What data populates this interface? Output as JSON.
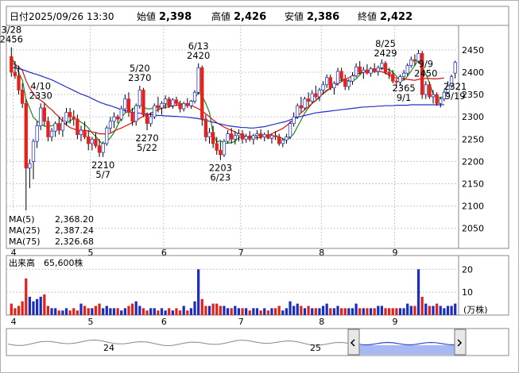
{
  "header": {
    "date_label": "日付",
    "date": "2025/09/26 13:30",
    "open_label": "始値",
    "open": "2,398",
    "high_label": "高値",
    "high": "2,426",
    "low_label": "安値",
    "low": "2,386",
    "close_label": "終値",
    "close": "2,422"
  },
  "colors": {
    "up": "#2b3fc5",
    "down": "#e8201a",
    "ma5": "#1a8a1a",
    "ma25": "#d81010",
    "ma75": "#2030c8",
    "volume_up": "#1a2dbb",
    "volume_down": "#e0201a",
    "high_value": "#e8201a",
    "low_value": "#1a8a1a",
    "grid": "#c8c8c8",
    "navigator_range": "#a8b8f0"
  },
  "legend": {
    "ma5_label": "MA(5)",
    "ma5_value": "2,368.20",
    "ma25_label": "MA(25)",
    "ma25_value": "2,387.24",
    "ma75_label": "MA(75)",
    "ma75_value": "2,326.68"
  },
  "volume_panel": {
    "label": "出来高",
    "value": "65,600株",
    "unit": "(万株)",
    "ticks": [
      "10",
      "20"
    ]
  },
  "navigator": {
    "labels": [
      "24",
      "25"
    ],
    "left_handle_icon": "chevron-left-icon",
    "right_handle_icon": "chevron-right-icon"
  },
  "chart_data": {
    "type": "candlestick",
    "title": "",
    "xlabel": "",
    "ylabel": "",
    "ylim": [
      2005,
      2505
    ],
    "y_ticks": [
      2050,
      2100,
      2150,
      2200,
      2250,
      2300,
      2350,
      2400,
      2450
    ],
    "x_month_ticks": [
      {
        "label": "4",
        "index": 1
      },
      {
        "label": "5",
        "index": 22
      },
      {
        "label": "6",
        "index": 42
      },
      {
        "label": "7",
        "index": 63
      },
      {
        "label": "8",
        "index": 85
      },
      {
        "label": "9",
        "index": 105
      }
    ],
    "grid": true,
    "legend_position": "bottom-left",
    "annotations": [
      {
        "date": "3/28",
        "value": "2456",
        "index": 0,
        "anchor": "high"
      },
      {
        "date": "4/10",
        "value": "2330",
        "index": 8,
        "anchor": "high"
      },
      {
        "date": "5/7",
        "value": "2210",
        "index": 25,
        "anchor": "low"
      },
      {
        "date": "5/20",
        "value": "2370",
        "index": 35,
        "anchor": "high"
      },
      {
        "date": "5/22",
        "value": "2270",
        "index": 37,
        "anchor": "low"
      },
      {
        "date": "6/13",
        "value": "2420",
        "index": 51,
        "anchor": "high"
      },
      {
        "date": "6/23",
        "value": "2203",
        "index": 57,
        "anchor": "low"
      },
      {
        "date": "8/25",
        "value": "2429",
        "index": 102,
        "anchor": "high"
      },
      {
        "date": "9/1",
        "value": "2365",
        "index": 107,
        "anchor": "low"
      },
      {
        "date": "9/9",
        "value": "2450",
        "index": 113,
        "anchor": "high"
      },
      {
        "date": "9/19",
        "value": "2321",
        "index": 121,
        "anchor": "low"
      }
    ],
    "candles": [
      [
        2435,
        2456,
        2390,
        2400
      ],
      [
        2400,
        2425,
        2385,
        2392
      ],
      [
        2392,
        2415,
        2350,
        2360
      ],
      [
        2360,
        2375,
        2320,
        2330
      ],
      [
        2330,
        2340,
        2060,
        2185
      ],
      [
        2185,
        2205,
        2140,
        2195
      ],
      [
        2200,
        2250,
        2160,
        2245
      ],
      [
        2245,
        2290,
        2230,
        2280
      ],
      [
        2280,
        2330,
        2270,
        2320
      ],
      [
        2320,
        2330,
        2280,
        2290
      ],
      [
        2290,
        2300,
        2245,
        2255
      ],
      [
        2255,
        2275,
        2245,
        2268
      ],
      [
        2268,
        2290,
        2255,
        2285
      ],
      [
        2285,
        2300,
        2260,
        2270
      ],
      [
        2270,
        2300,
        2255,
        2290
      ],
      [
        2290,
        2320,
        2280,
        2310
      ],
      [
        2310,
        2320,
        2285,
        2300
      ],
      [
        2300,
        2315,
        2280,
        2295
      ],
      [
        2295,
        2305,
        2250,
        2260
      ],
      [
        2260,
        2280,
        2245,
        2270
      ],
      [
        2270,
        2290,
        2250,
        2255
      ],
      [
        2255,
        2270,
        2225,
        2240
      ],
      [
        2240,
        2255,
        2225,
        2250
      ],
      [
        2250,
        2265,
        2230,
        2235
      ],
      [
        2235,
        2250,
        2210,
        2220
      ],
      [
        2220,
        2245,
        2210,
        2240
      ],
      [
        2240,
        2280,
        2235,
        2275
      ],
      [
        2275,
        2300,
        2265,
        2290
      ],
      [
        2290,
        2310,
        2275,
        2300
      ],
      [
        2300,
        2305,
        2285,
        2295
      ],
      [
        2295,
        2325,
        2290,
        2318
      ],
      [
        2318,
        2350,
        2310,
        2340
      ],
      [
        2340,
        2355,
        2300,
        2310
      ],
      [
        2310,
        2320,
        2280,
        2290
      ],
      [
        2290,
        2330,
        2280,
        2325
      ],
      [
        2325,
        2370,
        2318,
        2360
      ],
      [
        2360,
        2365,
        2300,
        2305
      ],
      [
        2305,
        2310,
        2270,
        2285
      ],
      [
        2285,
        2310,
        2278,
        2300
      ],
      [
        2300,
        2330,
        2295,
        2325
      ],
      [
        2325,
        2345,
        2310,
        2320
      ],
      [
        2320,
        2335,
        2305,
        2330
      ],
      [
        2330,
        2348,
        2318,
        2340
      ],
      [
        2340,
        2345,
        2320,
        2325
      ],
      [
        2325,
        2342,
        2318,
        2338
      ],
      [
        2338,
        2345,
        2325,
        2330
      ],
      [
        2330,
        2336,
        2310,
        2318
      ],
      [
        2318,
        2334,
        2312,
        2330
      ],
      [
        2330,
        2342,
        2320,
        2325
      ],
      [
        2325,
        2338,
        2318,
        2335
      ],
      [
        2335,
        2360,
        2330,
        2355
      ],
      [
        2355,
        2420,
        2350,
        2410
      ],
      [
        2410,
        2415,
        2280,
        2295
      ],
      [
        2295,
        2305,
        2245,
        2255
      ],
      [
        2255,
        2275,
        2240,
        2265
      ],
      [
        2265,
        2280,
        2230,
        2240
      ],
      [
        2240,
        2255,
        2215,
        2225
      ],
      [
        2225,
        2245,
        2203,
        2215
      ],
      [
        2215,
        2250,
        2210,
        2245
      ],
      [
        2245,
        2270,
        2240,
        2262
      ],
      [
        2262,
        2275,
        2240,
        2250
      ],
      [
        2250,
        2268,
        2238,
        2258
      ],
      [
        2258,
        2272,
        2245,
        2262
      ],
      [
        2262,
        2270,
        2240,
        2250
      ],
      [
        2250,
        2262,
        2242,
        2256
      ],
      [
        2256,
        2268,
        2245,
        2250
      ],
      [
        2250,
        2262,
        2238,
        2258
      ],
      [
        2258,
        2270,
        2248,
        2262
      ],
      [
        2262,
        2272,
        2250,
        2255
      ],
      [
        2255,
        2265,
        2245,
        2260
      ],
      [
        2260,
        2270,
        2250,
        2252
      ],
      [
        2252,
        2262,
        2240,
        2258
      ],
      [
        2258,
        2268,
        2248,
        2255
      ],
      [
        2255,
        2262,
        2235,
        2240
      ],
      [
        2240,
        2252,
        2232,
        2248
      ],
      [
        2248,
        2262,
        2240,
        2255
      ],
      [
        2255,
        2290,
        2250,
        2285
      ],
      [
        2285,
        2310,
        2278,
        2300
      ],
      [
        2300,
        2330,
        2295,
        2325
      ],
      [
        2325,
        2345,
        2310,
        2320
      ],
      [
        2320,
        2345,
        2315,
        2340
      ],
      [
        2340,
        2355,
        2325,
        2335
      ],
      [
        2335,
        2360,
        2330,
        2352
      ],
      [
        2352,
        2370,
        2340,
        2345
      ],
      [
        2345,
        2365,
        2335,
        2360
      ],
      [
        2360,
        2380,
        2350,
        2372
      ],
      [
        2372,
        2395,
        2365,
        2388
      ],
      [
        2388,
        2395,
        2360,
        2365
      ],
      [
        2365,
        2380,
        2350,
        2375
      ],
      [
        2375,
        2410,
        2370,
        2402
      ],
      [
        2402,
        2410,
        2380,
        2385
      ],
      [
        2385,
        2395,
        2360,
        2368
      ],
      [
        2368,
        2385,
        2360,
        2380
      ],
      [
        2380,
        2400,
        2372,
        2392
      ],
      [
        2392,
        2420,
        2388,
        2412
      ],
      [
        2412,
        2425,
        2395,
        2400
      ],
      [
        2400,
        2412,
        2385,
        2405
      ],
      [
        2405,
        2418,
        2395,
        2398
      ],
      [
        2398,
        2412,
        2390,
        2408
      ],
      [
        2408,
        2420,
        2398,
        2402
      ],
      [
        2402,
        2415,
        2392,
        2410
      ],
      [
        2410,
        2429,
        2405,
        2420
      ],
      [
        2420,
        2425,
        2395,
        2400
      ],
      [
        2400,
        2410,
        2385,
        2395
      ],
      [
        2395,
        2405,
        2375,
        2380
      ],
      [
        2380,
        2385,
        2365,
        2378
      ],
      [
        2378,
        2395,
        2370,
        2390
      ],
      [
        2390,
        2405,
        2382,
        2398
      ],
      [
        2398,
        2420,
        2392,
        2415
      ],
      [
        2415,
        2435,
        2410,
        2428
      ],
      [
        2428,
        2440,
        2415,
        2425
      ],
      [
        2425,
        2450,
        2420,
        2442
      ],
      [
        2442,
        2448,
        2340,
        2350
      ],
      [
        2350,
        2380,
        2340,
        2372
      ],
      [
        2372,
        2378,
        2340,
        2345
      ],
      [
        2345,
        2360,
        2330,
        2350
      ],
      [
        2350,
        2355,
        2325,
        2330
      ],
      [
        2330,
        2345,
        2321,
        2340
      ],
      [
        2340,
        2360,
        2335,
        2355
      ],
      [
        2355,
        2380,
        2350,
        2370
      ],
      [
        2370,
        2395,
        2365,
        2390
      ],
      [
        2398,
        2426,
        2386,
        2422
      ]
    ],
    "volumes": [
      5,
      3,
      4,
      6,
      16,
      8,
      6,
      7,
      8,
      9,
      4,
      3,
      3,
      2,
      2,
      3,
      2,
      3,
      2,
      5,
      4,
      3,
      3,
      4,
      5,
      3,
      4,
      3,
      3,
      3,
      2,
      3,
      4,
      5,
      6,
      4,
      3,
      2,
      3,
      3,
      2,
      3,
      2,
      3,
      2,
      3,
      2,
      4,
      2,
      3,
      6,
      20,
      7,
      4,
      4,
      5,
      5,
      4,
      4,
      3,
      3,
      4,
      3,
      3,
      3,
      2,
      3,
      3,
      2,
      3,
      2,
      3,
      3,
      4,
      2,
      3,
      6,
      4,
      5,
      4,
      3,
      4,
      3,
      3,
      3,
      4,
      5,
      3,
      3,
      4,
      3,
      3,
      3,
      3,
      5,
      3,
      3,
      3,
      3,
      3,
      4,
      4,
      3,
      3,
      3,
      3,
      3,
      3,
      5,
      4,
      4,
      20,
      8,
      5,
      4,
      4,
      5,
      4,
      3,
      4,
      4,
      5
    ],
    "series": [
      {
        "name": "MA(5)",
        "values": [
          2435,
          2418,
          2399,
          2382,
          2339,
          2319,
          2299,
          2291,
          2285,
          2279,
          2278,
          2280,
          2283,
          2281,
          2282,
          2285,
          2291,
          2296,
          2294,
          2288,
          2283,
          2275,
          2264,
          2256,
          2246,
          2238,
          2244,
          2253,
          2265,
          2281,
          2298,
          2309,
          2311,
          2317,
          2323,
          2328,
          2322,
          2318,
          2318,
          2322,
          2323,
          2320,
          2326,
          2329,
          2331,
          2333,
          2330,
          2328,
          2329,
          2329,
          2341,
          2355,
          2347,
          2330,
          2310,
          2263,
          2243,
          2247,
          2240,
          2241,
          2242,
          2245,
          2253,
          2256,
          2255,
          2257,
          2256,
          2258,
          2258,
          2259,
          2258,
          2258,
          2257,
          2255,
          2251,
          2248,
          2254,
          2262,
          2278,
          2293,
          2309,
          2320,
          2330,
          2336,
          2343,
          2353,
          2360,
          2364,
          2372,
          2379,
          2383,
          2384,
          2380,
          2380,
          2385,
          2394,
          2402,
          2404,
          2406,
          2404,
          2405,
          2409,
          2406,
          2406,
          2400,
          2391,
          2381,
          2382,
          2391,
          2403,
          2415,
          2429,
          2411,
          2396,
          2376,
          2351,
          2344,
          2343,
          2345,
          2361,
          2382
        ]
      },
      {
        "name": "MA(25)",
        "values": [
          2420,
          2418,
          2412,
          2404,
          2381,
          2364,
          2352,
          2342,
          2337,
          2331,
          2322,
          2316,
          2307,
          2300,
          2290,
          2282,
          2276,
          2273,
          2270,
          2270,
          2270,
          2268,
          2266,
          2265,
          2262,
          2262,
          2261,
          2263,
          2268,
          2272,
          2275,
          2279,
          2283,
          2287,
          2291,
          2297,
          2301,
          2305,
          2308,
          2312,
          2316,
          2319,
          2321,
          2323,
          2324,
          2326,
          2327,
          2326,
          2326,
          2325,
          2322,
          2318,
          2313,
          2307,
          2300,
          2293,
          2287,
          2282,
          2277,
          2273,
          2270,
          2266,
          2262,
          2259,
          2256,
          2254,
          2253,
          2253,
          2254,
          2257,
          2259,
          2262,
          2266,
          2270,
          2274,
          2280,
          2287,
          2294,
          2302,
          2309,
          2316,
          2323,
          2330,
          2337,
          2345,
          2352,
          2358,
          2364,
          2369,
          2374,
          2379,
          2384,
          2388,
          2392,
          2395,
          2398,
          2400,
          2401,
          2402,
          2402,
          2402,
          2401,
          2398,
          2393,
          2389,
          2387,
          2386,
          2385,
          2384,
          2383,
          2382,
          2384,
          2385,
          2386,
          2386,
          2385,
          2385,
          2386,
          2387
        ]
      },
      {
        "name": "MA(75)",
        "values": [
          2410,
          2410,
          2408,
          2406,
          2403,
          2400,
          2397,
          2395,
          2392,
          2389,
          2386,
          2383,
          2379,
          2375,
          2371,
          2367,
          2363,
          2359,
          2355,
          2351,
          2348,
          2345,
          2341,
          2337,
          2333,
          2330,
          2327,
          2325,
          2322,
          2319,
          2316,
          2314,
          2312,
          2310,
          2309,
          2308,
          2307,
          2306,
          2305,
          2304,
          2303,
          2303,
          2302,
          2302,
          2301,
          2301,
          2300,
          2300,
          2299,
          2298,
          2297,
          2296,
          2294,
          2292,
          2290,
          2288,
          2286,
          2284,
          2282,
          2280,
          2279,
          2278,
          2277,
          2276,
          2276,
          2275,
          2275,
          2276,
          2277,
          2278,
          2280,
          2282,
          2284,
          2286,
          2288,
          2290,
          2293,
          2296,
          2299,
          2301,
          2303,
          2305,
          2307,
          2309,
          2310,
          2311,
          2312,
          2313,
          2314,
          2315,
          2316,
          2317,
          2318,
          2319,
          2320,
          2321,
          2322,
          2322,
          2323,
          2323,
          2324,
          2324,
          2325,
          2325,
          2325,
          2326,
          2326,
          2326,
          2326,
          2327,
          2327,
          2327,
          2327,
          2327,
          2327,
          2327,
          2327,
          2327,
          2327
        ]
      }
    ]
  }
}
